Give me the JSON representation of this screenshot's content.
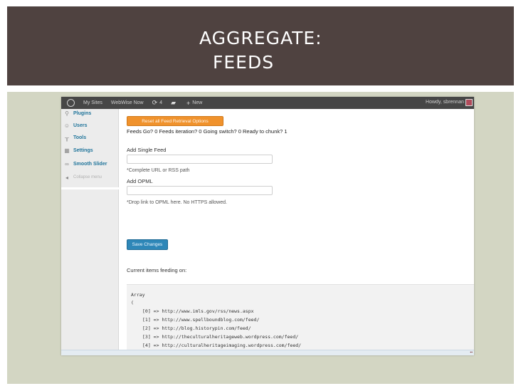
{
  "slide": {
    "title_line1": "AGGREGATE:",
    "title_line2": "FEEDS"
  },
  "adminbar": {
    "my_sites": "My Sites",
    "site_name": "WebWise Now",
    "updates_count": "4",
    "new_label": "New",
    "howdy": "Howdy, sbrennan"
  },
  "sidebar": {
    "items": [
      {
        "label": "Plugins",
        "icon": "plug-icon"
      },
      {
        "label": "Users",
        "icon": "users-icon"
      },
      {
        "label": "Tools",
        "icon": "tools-icon"
      },
      {
        "label": "Settings",
        "icon": "settings-icon"
      },
      {
        "label": "Smooth Slider",
        "icon": "slider-icon"
      }
    ],
    "collapse_label": "Collapse menu"
  },
  "content": {
    "reset_button": "Reset all Feed Retrieval Options",
    "status": "Feeds Go? 0 Feeds iteration? 0 Going switch? 0 Ready to chunk? 1",
    "single_feed_label": "Add Single Feed",
    "single_feed_hint": "*Complete URL or RSS path",
    "opml_label": "Add OPML",
    "opml_hint": "*Drop link to OPML here. No HTTPS allowed.",
    "save_button": "Save Changes",
    "current_items_label": "Current items feeding on:",
    "code": {
      "array_kw": "Array",
      "open_paren": "(",
      "lines": [
        "[0] => http://www.imls.gov/rss/news.aspx",
        "[1] => http://www.spellboundblog.com/feed/",
        "[2] => http://blog.historypin.com/feed/",
        "[3] => http://theculturalheritageweb.wordpress.com/feed/",
        "[4] => http://culturalheritageimaging.wordpress.com/feed/"
      ]
    }
  },
  "colors": {
    "header_bg": "#4f4240",
    "body_bg": "#d3d6c3",
    "reset_button": "#f0922c",
    "save_button": "#2e87b8",
    "admin_bar": "#464646"
  }
}
